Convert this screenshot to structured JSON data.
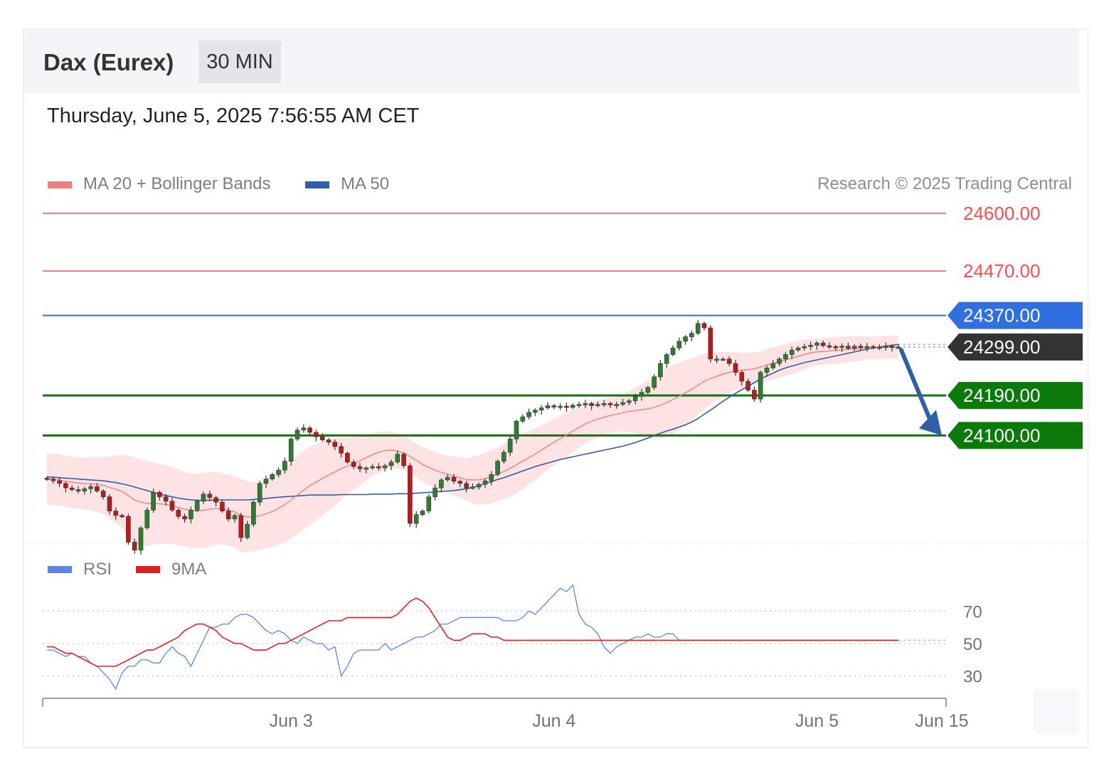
{
  "header": {
    "instrument": "Dax (Eurex)",
    "timeframe": "30 MIN"
  },
  "datetime": "Thursday, June 5, 2025 7:56:55 AM CET",
  "legend": {
    "ma20": {
      "label": "MA 20 + Bollinger Bands",
      "color": "#f08080"
    },
    "ma50": {
      "label": "MA 50",
      "color": "#2f5fa8"
    }
  },
  "credit": "Research © 2025 Trading Central",
  "rsi_legend": {
    "rsi": {
      "label": "RSI",
      "color": "#5b86e5"
    },
    "ma9": {
      "label": "9MA",
      "color": "#e02020"
    }
  },
  "chart_data": [
    {
      "type": "candlestick",
      "ylim": [
        23835,
        24635
      ],
      "x_ticks": [
        "Jun 3",
        "Jun 4",
        "Jun 5",
        "Jun 15"
      ],
      "levels": [
        {
          "label": "24600.00",
          "value": 24600,
          "kind": "resistance",
          "color": "#ff4d4d"
        },
        {
          "label": "24470.00",
          "value": 24470,
          "kind": "resistance",
          "color": "#ff4d4d"
        },
        {
          "label": "24370.00",
          "value": 24370,
          "kind": "pivot",
          "color": "#2f6fe0"
        },
        {
          "label": "24299.00",
          "value": 24299,
          "kind": "last",
          "color": "#333333"
        },
        {
          "label": "24190.00",
          "value": 24190,
          "kind": "support",
          "color": "#0a7a0a"
        },
        {
          "label": "24100.00",
          "value": 24100,
          "kind": "support",
          "color": "#0a7a0a"
        }
      ],
      "close": [
        24002,
        23998,
        23992,
        23982,
        23978,
        23975,
        23980,
        23985,
        23975,
        23962,
        23930,
        23920,
        23918,
        23860,
        23842,
        23892,
        23932,
        23972,
        23962,
        23952,
        23932,
        23918,
        23912,
        23932,
        23952,
        23968,
        23960,
        23950,
        23930,
        23912,
        23920,
        23870,
        23900,
        23950,
        23992,
        24002,
        24012,
        24022,
        24042,
        24092,
        24112,
        24117,
        24107,
        24097,
        24090,
        24085,
        24075,
        24060,
        24040,
        24030,
        24025,
        24027,
        24030,
        24027,
        24032,
        24040,
        24058,
        24032,
        23902,
        23922,
        23930,
        23962,
        23982,
        24000,
        24006,
        23997,
        23992,
        23982,
        23984,
        23990,
        23998,
        24012,
        24042,
        24062,
        24092,
        24132,
        24142,
        24152,
        24157,
        24162,
        24167,
        24165,
        24166,
        24163,
        24168,
        24170,
        24172,
        24167,
        24170,
        24172,
        24170,
        24170,
        24174,
        24178,
        24188,
        24197,
        24208,
        24232,
        24262,
        24282,
        24297,
        24312,
        24322,
        24330,
        24352,
        24342,
        24272,
        24272,
        24272,
        24262,
        24242,
        24222,
        24202,
        24182,
        24242,
        24252,
        24262,
        24272,
        24282,
        24292,
        24297,
        24300,
        24303,
        24308,
        24302,
        24300,
        24298,
        24301,
        24296,
        24301,
        24299,
        24300,
        24298,
        24299,
        24301,
        24299,
        24299
      ],
      "ma20": [
        24002,
        24001,
        24000,
        23997,
        23995,
        23993,
        23992,
        23991,
        23990,
        23988,
        23983,
        23979,
        23974,
        23965,
        23955,
        23950,
        23947,
        23947,
        23946,
        23945,
        23942,
        23938,
        23934,
        23931,
        23930,
        23932,
        23934,
        23936,
        23935,
        23932,
        23928,
        23920,
        23917,
        23917,
        23919,
        23924,
        23929,
        23936,
        23944,
        23955,
        23966,
        23977,
        23987,
        23995,
        24003,
        24011,
        24018,
        24025,
        24031,
        24037,
        24043,
        24050,
        24057,
        24062,
        24066,
        24067,
        24065,
        24061,
        24053,
        24044,
        24035,
        24028,
        24022,
        24017,
        24013,
        24008,
        24005,
        24001,
        24000,
        24000,
        24003,
        24007,
        24013,
        24019,
        24026,
        24034,
        24042,
        24050,
        24058,
        24067,
        24076,
        24085,
        24093,
        24101,
        24110,
        24118,
        24126,
        24132,
        24137,
        24141,
        24145,
        24148,
        24151,
        24154,
        24156,
        24158,
        24160,
        24163,
        24168,
        24174,
        24181,
        24188,
        24196,
        24204,
        24213,
        24222,
        24228,
        24233,
        24238,
        24242,
        24245,
        24247,
        24248,
        24250,
        24254,
        24259,
        24262,
        24266,
        24270,
        24274,
        24278,
        24282,
        24286,
        24288,
        24289,
        24290,
        24291,
        24293,
        24294,
        24295,
        24296,
        24297,
        24297,
        24298,
        24298,
        24299,
        24299
      ],
      "ma50": [
        24007,
        24006,
        24005,
        24004,
        24003,
        24002,
        24001,
        24000,
        23999,
        23998,
        23996,
        23994,
        23991,
        23988,
        23984,
        23980,
        23976,
        23972,
        23968,
        23965,
        23962,
        23959,
        23957,
        23955,
        23954,
        23954,
        23954,
        23955,
        23955,
        23955,
        23955,
        23955,
        23955,
        23956,
        23957,
        23958,
        23960,
        23961,
        23962,
        23963,
        23964,
        23965,
        23966,
        23966,
        23966,
        23966,
        23966,
        23967,
        23967,
        23967,
        23967,
        23967,
        23968,
        23968,
        23968,
        23968,
        23969,
        23969,
        23969,
        23970,
        23971,
        23972,
        23973,
        23974,
        23975,
        23976,
        23978,
        23980,
        23983,
        23987,
        23992,
        23996,
        24001,
        24005,
        24010,
        24015,
        24020,
        24025,
        24030,
        24034,
        24038,
        24042,
        24046,
        24049,
        24052,
        24055,
        24058,
        24061,
        24064,
        24067,
        24070,
        24073,
        24076,
        24080,
        24084,
        24089,
        24094,
        24100,
        24105,
        24110,
        24114,
        24119,
        24124,
        24130,
        24138,
        24148,
        24157,
        24167,
        24177,
        24186,
        24195,
        24203,
        24211,
        24219,
        24227,
        24234,
        24240,
        24247,
        24252,
        24256,
        24260,
        24264,
        24267,
        24270,
        24273,
        24276,
        24279,
        24282,
        24285,
        24288,
        24291,
        24294,
        24297,
        24299,
        24301,
        24303,
        24305
      ],
      "bb_half_width": [
        58,
        58,
        58,
        58,
        58,
        58,
        58,
        60,
        62,
        64,
        70,
        76,
        82,
        90,
        96,
        96,
        96,
        92,
        90,
        88,
        86,
        85,
        84,
        84,
        84,
        84,
        84,
        82,
        80,
        80,
        80,
        82,
        80,
        78,
        76,
        78,
        80,
        82,
        84,
        86,
        88,
        88,
        88,
        86,
        84,
        80,
        76,
        70,
        64,
        60,
        56,
        52,
        48,
        46,
        44,
        42,
        40,
        40,
        38,
        38,
        40,
        40,
        40,
        40,
        42,
        44,
        46,
        48,
        52,
        56,
        58,
        60,
        60,
        62,
        64,
        64,
        62,
        60,
        58,
        56,
        54,
        52,
        50,
        50,
        48,
        46,
        44,
        42,
        42,
        40,
        40,
        40,
        42,
        46,
        52,
        58,
        64,
        70,
        74,
        78,
        78,
        76,
        74,
        70,
        66,
        62,
        58,
        54,
        50,
        46,
        42,
        40,
        38,
        36,
        36,
        36,
        36,
        36,
        36,
        36,
        36,
        34,
        32,
        30,
        30,
        30,
        30,
        30,
        30,
        28,
        28,
        26,
        26,
        26,
        26,
        26,
        26
      ]
    },
    {
      "type": "line",
      "ylim": [
        15,
        85
      ],
      "y_ticks": [
        70,
        50,
        30
      ],
      "series": [
        {
          "name": "RSI",
          "values": [
            46,
            46,
            44,
            42,
            44,
            42,
            42,
            38,
            36,
            32,
            28,
            22,
            32,
            36,
            36,
            40,
            40,
            38,
            38,
            44,
            48,
            44,
            42,
            36,
            44,
            52,
            60,
            60,
            62,
            62,
            66,
            68,
            68,
            66,
            62,
            58,
            56,
            58,
            56,
            52,
            50,
            54,
            52,
            50,
            50,
            46,
            48,
            30,
            36,
            44,
            46,
            46,
            46,
            46,
            50,
            46,
            48,
            50,
            52,
            54,
            54,
            56,
            58,
            62,
            62,
            64,
            66,
            66,
            66,
            66,
            66,
            66,
            66,
            64,
            64,
            64,
            66,
            70,
            68,
            72,
            76,
            80,
            84,
            82,
            86,
            68,
            62,
            60,
            56,
            48,
            44,
            48,
            50,
            52,
            54,
            54,
            56,
            54,
            54,
            56,
            56,
            52,
            52,
            52,
            52,
            52,
            52,
            52,
            52,
            52,
            52,
            52,
            52,
            52,
            52,
            52,
            52,
            52,
            52,
            52,
            52,
            52,
            52,
            52,
            52,
            52,
            52,
            52,
            52,
            52,
            52,
            52,
            52,
            52,
            52,
            52,
            52
          ]
        },
        {
          "name": "9MA",
          "values": [
            48,
            48,
            46,
            44,
            44,
            42,
            40,
            38,
            36,
            36,
            36,
            36,
            38,
            40,
            42,
            44,
            46,
            46,
            48,
            50,
            52,
            54,
            58,
            60,
            62,
            62,
            60,
            58,
            54,
            52,
            50,
            50,
            48,
            46,
            46,
            46,
            48,
            50,
            50,
            52,
            54,
            56,
            58,
            60,
            62,
            64,
            64,
            64,
            66,
            66,
            66,
            66,
            66,
            66,
            66,
            66,
            68,
            72,
            76,
            78,
            76,
            72,
            66,
            60,
            54,
            52,
            52,
            54,
            56,
            56,
            56,
            54,
            54,
            52,
            52,
            52,
            52,
            52,
            52,
            52,
            52,
            52,
            52,
            52,
            52,
            52,
            52,
            52,
            52,
            52,
            52,
            52,
            52,
            52,
            52,
            52,
            52,
            52,
            52,
            52,
            52,
            52,
            52,
            52,
            52,
            52,
            52,
            52,
            52,
            52,
            52,
            52,
            52,
            52,
            52,
            52,
            52,
            52,
            52,
            52,
            52,
            52,
            52,
            52,
            52,
            52,
            52,
            52,
            52,
            52,
            52,
            52,
            52,
            52,
            52,
            52,
            52
          ]
        }
      ]
    }
  ]
}
